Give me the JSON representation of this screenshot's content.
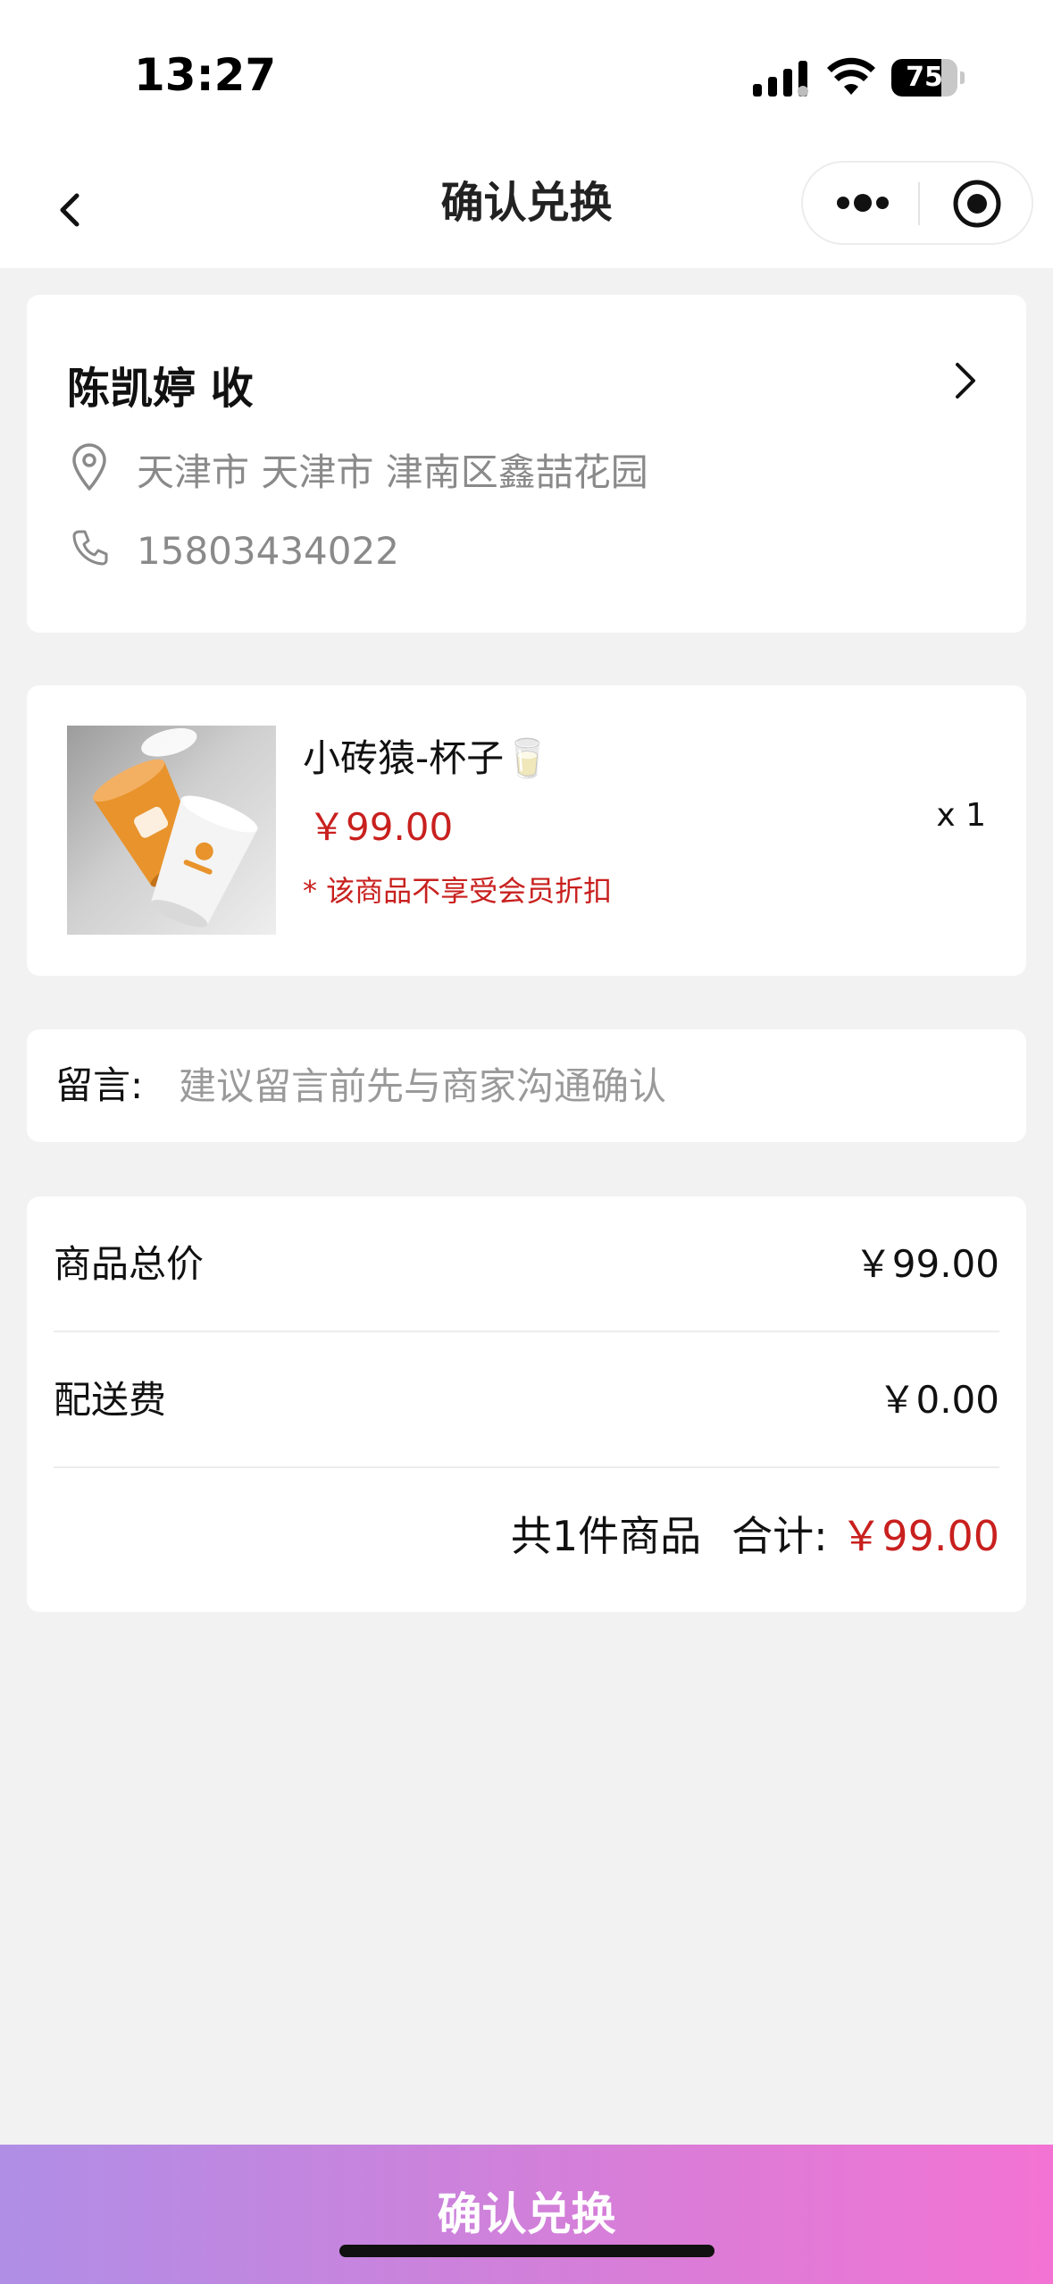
{
  "status_bar": {
    "time": "13:27",
    "battery": 75,
    "battery_label": "75"
  },
  "nav": {
    "title": "确认兑换",
    "icons": {
      "back": "chevron-left-icon",
      "more": "more-dots-icon",
      "close": "target-circle-icon"
    }
  },
  "address": {
    "recipient": "陈凯婷 收",
    "location": "天津市 天津市 津南区鑫喆花园",
    "phone": "15803434022",
    "icons": {
      "location": "location-pin-icon",
      "phone": "phone-icon",
      "arrow": "chevron-right-icon"
    }
  },
  "goods": {
    "title": "小砖猿-杯子🥛",
    "price": "￥99.00",
    "note": "* 该商品不享受会员折扣",
    "quantity": "x 1"
  },
  "message": {
    "label": "留言:",
    "placeholder": "建议留言前先与商家沟通确认",
    "value": ""
  },
  "summary": {
    "goods_total_label": "商品总价",
    "goods_total_value": "￥99.00",
    "shipping_label": "配送费",
    "shipping_value": "￥0.00",
    "count_text": "共1件商品",
    "total_label": "合计:",
    "total_value": "￥99.00"
  },
  "footer": {
    "confirm_label": "确认兑换"
  },
  "colors": {
    "price_red": "#c8201e",
    "button_gradient_start": "#b08ee6",
    "button_gradient_end": "#f373d3"
  }
}
